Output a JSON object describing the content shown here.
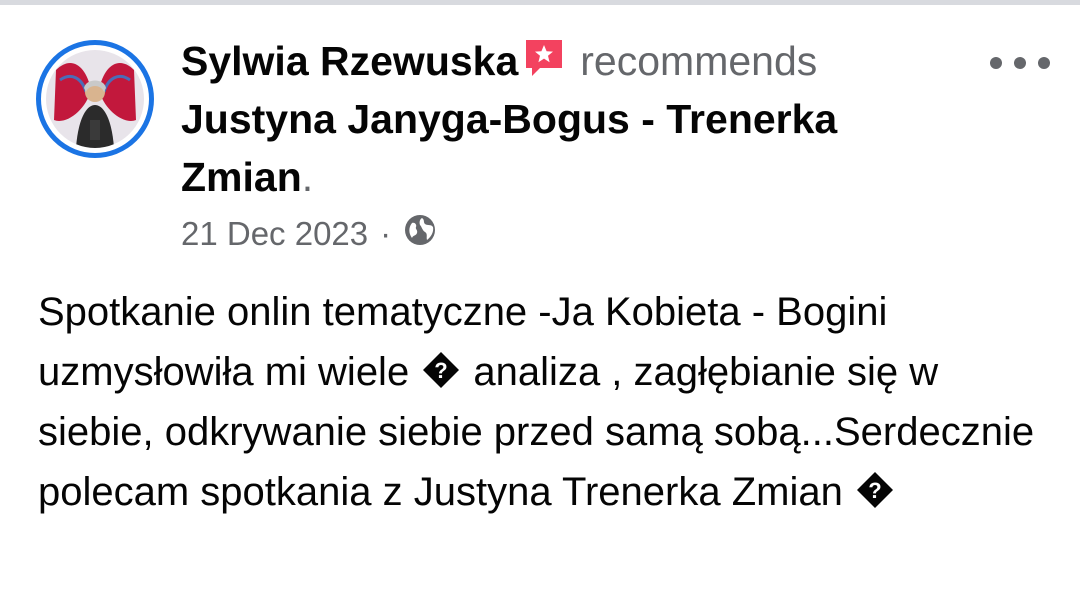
{
  "post": {
    "author": "Sylwia Rzewuska",
    "verb": "recommends",
    "page_name": "Justyna Janyga-Bogus - Trenerka Zmian",
    "period": ".",
    "date": "21 Dec 2023",
    "separator": "·",
    "audience_icon": "globe-icon",
    "badge_icon": "recommend-star-icon",
    "more_icon": "more-options-icon",
    "text_part1": "Spotkanie onlin tematyczne -Ja Kobieta - Bogini uzmysłowiła mi wiele ",
    "text_part2": " analiza , zagłębianie się w siebie, odkrywanie siebie przed samą sobą...Serdecznie polecam spotkania z Justyna Trenerka Zmian ",
    "colors": {
      "avatar_ring": "#1b74e4",
      "badge": "#f3425f",
      "secondary_text": "#65676b"
    }
  }
}
